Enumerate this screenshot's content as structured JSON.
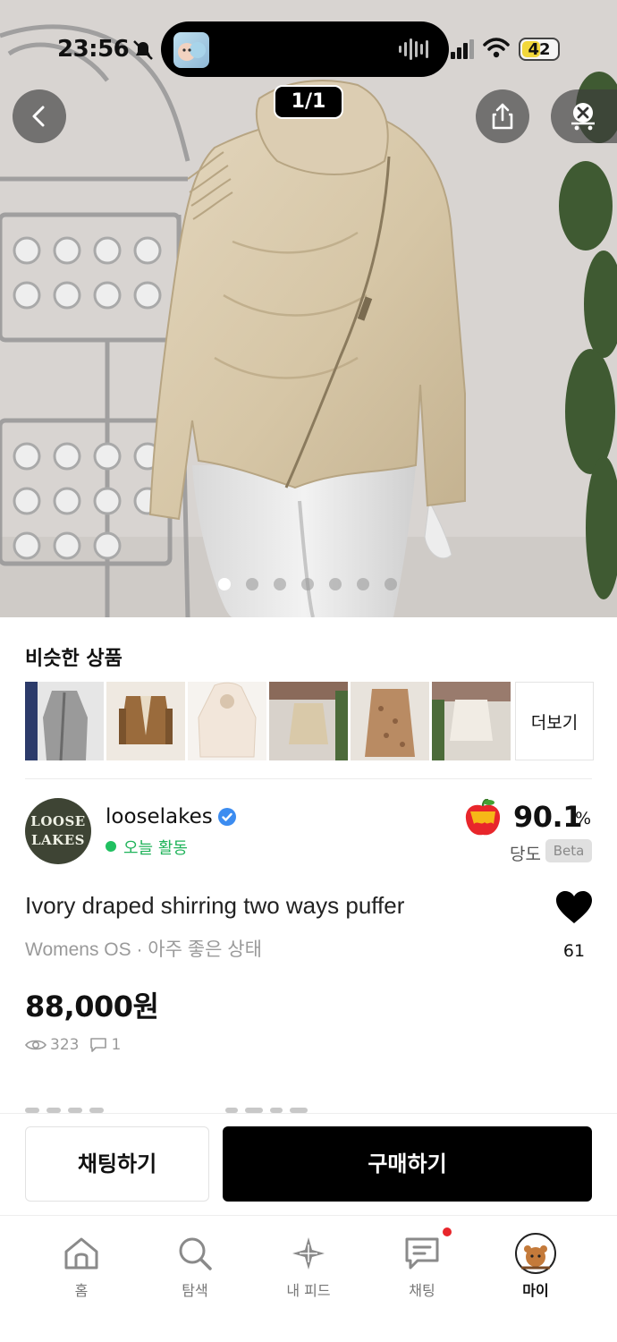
{
  "status_bar": {
    "time": "23:56",
    "battery": "42"
  },
  "gallery": {
    "indicator": "1/1",
    "dot_count": 7,
    "active_dot": 1
  },
  "similar": {
    "title": "비슷한 상품",
    "more_label": "더보기",
    "items": [
      "grey-knit-cardigan",
      "brown-shearling-jacket",
      "cream-hooded-coat",
      "beige-knit-sweater",
      "tweed-coat",
      "white-layered-top"
    ]
  },
  "seller": {
    "name": "looselakes",
    "avatar_text_line1": "LOOSE",
    "avatar_text_line2": "LAKES",
    "activity": "오늘 활동",
    "rating_value": "90.1",
    "rating_unit": "%",
    "rating_label": "당도",
    "beta_label": "Beta"
  },
  "product": {
    "title": "Ivory draped shirring two ways puffer",
    "subtitle": "Womens OS · 아주 좋은 상태",
    "likes": "61",
    "price": "88,000원",
    "views": "323",
    "comments": "1"
  },
  "actions": {
    "chat_label": "채팅하기",
    "buy_label": "구매하기"
  },
  "tabs": [
    {
      "label": "홈",
      "icon": "home-icon"
    },
    {
      "label": "탐색",
      "icon": "search-icon"
    },
    {
      "label": "내 피드",
      "icon": "sparkle-icon"
    },
    {
      "label": "채팅",
      "icon": "chat-icon"
    },
    {
      "label": "마이",
      "icon": "profile-avatar"
    }
  ],
  "colors": {
    "accent_black": "#000000",
    "active_green": "#20b35a",
    "notification_red": "#e8262b",
    "verified_blue": "#3c8cf0"
  }
}
